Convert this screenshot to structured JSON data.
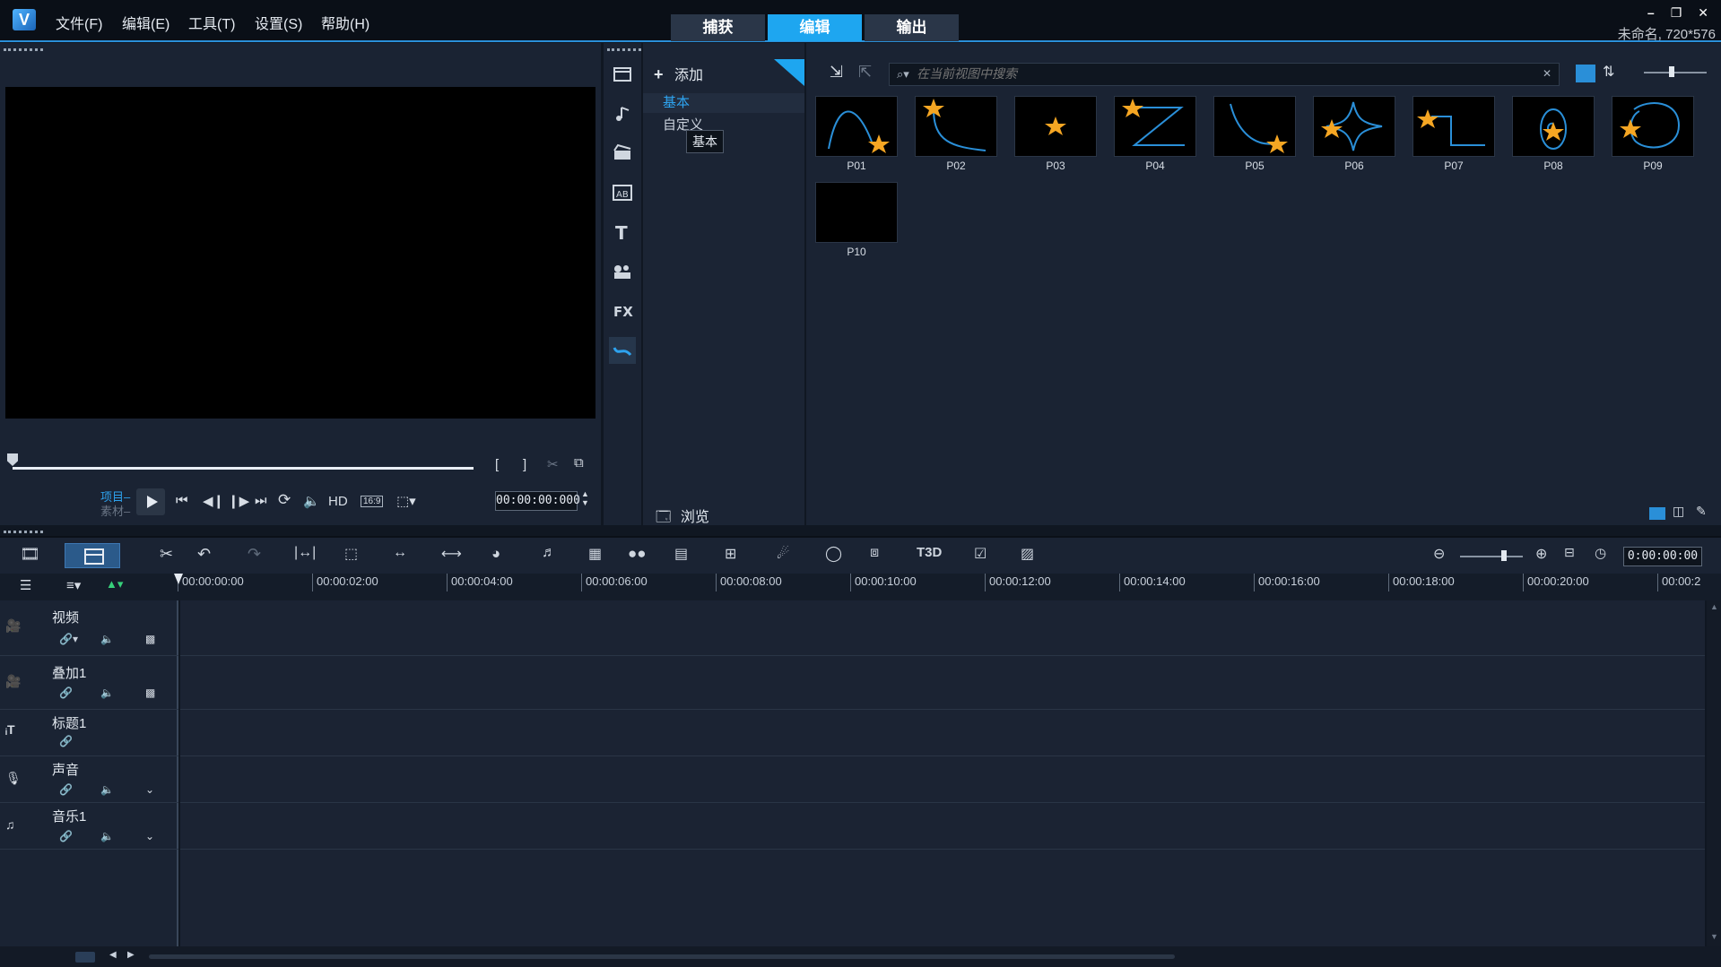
{
  "menu": [
    "文件(F)",
    "编辑(E)",
    "工具(T)",
    "设置(S)",
    "帮助(H)"
  ],
  "mode_tabs": [
    "捕获",
    "编辑",
    "输出"
  ],
  "project_name": "未命名, 720*576",
  "window_controls": [
    "minimize-icon",
    "restore-icon",
    "close-icon"
  ],
  "preview": {
    "mode_labels": [
      "项目–",
      "素材–"
    ],
    "hd_label": "HD",
    "aspect_label": "16:9",
    "timecode": "00:00:00:000"
  },
  "library": {
    "add_label": "添加",
    "folders": [
      "基本",
      "自定义"
    ],
    "tooltip": "基本",
    "browse_label": "浏览",
    "search_placeholder": "在当前视图中搜索",
    "items": [
      "P01",
      "P02",
      "P03",
      "P04",
      "P05",
      "P06",
      "P07",
      "P08",
      "P09",
      "P10"
    ]
  },
  "timeline": {
    "timecode": "0:00:00:00",
    "ruler": [
      "00:00:00:00",
      "00:00:02:00",
      "00:00:04:00",
      "00:00:06:00",
      "00:00:08:00",
      "00:00:10:00",
      "00:00:12:00",
      "00:00:14:00",
      "00:00:16:00",
      "00:00:18:00",
      "00:00:20:00",
      "00:00:2"
    ],
    "tracks": [
      {
        "name": "视频",
        "icon": "video-track-icon"
      },
      {
        "name": "叠加1",
        "icon": "overlay-track-icon"
      },
      {
        "name": "标题1",
        "icon": "title-track-icon"
      },
      {
        "name": "声音",
        "icon": "voice-track-icon"
      },
      {
        "name": "音乐1",
        "icon": "music-track-icon"
      }
    ]
  },
  "colors": {
    "accent": "#1ea6f0",
    "background": "#1a2333",
    "star": "#f5a623",
    "path": "#2a8fd8"
  }
}
